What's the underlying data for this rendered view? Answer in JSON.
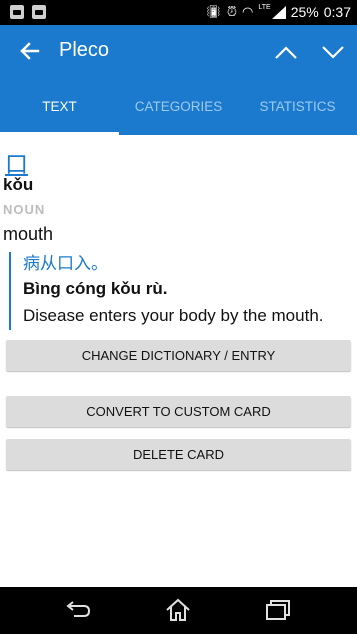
{
  "status_bar": {
    "battery": "25%",
    "time": "0:37",
    "network": "LTE",
    "icons": [
      "notification-icon-1",
      "notification-icon-2",
      "vibrate-icon",
      "alarm-icon",
      "wifi-icon",
      "signal-icon",
      "battery-icon"
    ]
  },
  "app_bar": {
    "title": "Pleco",
    "back_icon": "arrow-left-icon",
    "prev_icon": "chevron-up-icon",
    "next_icon": "chevron-down-icon"
  },
  "tabs": [
    {
      "label": "TEXT",
      "active": true
    },
    {
      "label": "CATEGORIES",
      "active": false
    },
    {
      "label": "STATISTICS",
      "active": false
    }
  ],
  "entry": {
    "headword": "口",
    "pinyin": "kǒu",
    "part_of_speech": "NOUN",
    "definition": "mouth",
    "example": {
      "hanzi": "病从口入。",
      "pinyin_before": "Bìng cóng ",
      "pinyin_highlight": "kǒu",
      "pinyin_after": " rù.",
      "english": "Disease enters your body by the mouth."
    }
  },
  "buttons": {
    "change_dictionary": "CHANGE DICTIONARY / ENTRY",
    "convert": "CONVERT TO CUSTOM CARD",
    "delete": "DELETE CARD"
  },
  "colors": {
    "accent": "#1B7ACD",
    "button_bg": "#dcdcdc",
    "pos_gray": "#bdbdbd"
  },
  "nav_bar": {
    "icons": [
      "back-nav-icon",
      "home-nav-icon",
      "recents-nav-icon"
    ]
  }
}
